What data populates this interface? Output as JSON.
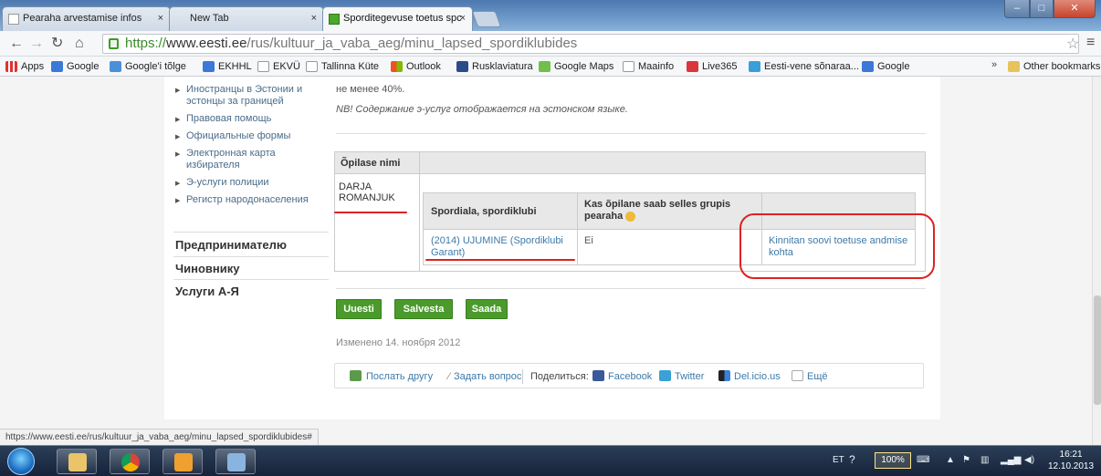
{
  "tabs": [
    {
      "title": "Pearaha arvestamise infos"
    },
    {
      "title": "New Tab"
    },
    {
      "title": "Sporditegevuse toetus spc"
    }
  ],
  "address": {
    "scheme": "https://",
    "host": "www.eesti.ee",
    "path": "/rus/kultuur_ja_vaba_aeg/minu_lapsed_spordiklubides"
  },
  "bookmarks": {
    "items": [
      {
        "label": "Apps",
        "icon": "apps-icon"
      },
      {
        "label": "Google",
        "icon": "google-icon"
      },
      {
        "label": "Google'i tõlge",
        "icon": "translate-icon"
      },
      {
        "label": "EKHHL",
        "icon": "google-icon"
      },
      {
        "label": "EKVÜ",
        "icon": "page-icon"
      },
      {
        "label": "Tallinna Küte",
        "icon": "page-icon"
      },
      {
        "label": "Outlook",
        "icon": "outlook-icon"
      },
      {
        "label": "Rusklaviatura",
        "icon": "rk-icon"
      },
      {
        "label": "Google Maps",
        "icon": "maps-icon"
      },
      {
        "label": "Maainfo",
        "icon": "page-icon"
      },
      {
        "label": "Live365",
        "icon": "live365-icon"
      },
      {
        "label": "Eesti-vene sõnaraa...",
        "icon": "dictionary-icon"
      },
      {
        "label": "Google",
        "icon": "google-icon"
      }
    ],
    "more": "»",
    "other": "Other bookmarks"
  },
  "leftnav": {
    "items": [
      "Иностранцы в Эстонии и эстонцы за границей",
      "Правовая помощь",
      "Официальные формы",
      "Электронная карта избирателя",
      "Э-услуги полиции",
      "Регистр народонаселения"
    ],
    "sections": [
      "Предпринимателю",
      "Чиновнику",
      "Услуги А-Я"
    ]
  },
  "main": {
    "top_text": "не менее 40%.",
    "note": "NB! Содержание э-услуг отображается на эстонском языке.",
    "outer_header": "Õpilase nimi",
    "student_first": "DARJA",
    "student_last": "ROMANJUK",
    "inner_headers": {
      "col1": "Spordiala, spordiklubi",
      "col2_line1": "Kas õpilane saab selles grupis",
      "col2_line2": "pearaha"
    },
    "row": {
      "club_line1": "(2014) UJUMINE (Spordiklubi",
      "club_line2": "Garant)",
      "gets": "Ei",
      "confirm_line1": "Kinnitan soovi toetuse andmise",
      "confirm_line2": "kohta"
    },
    "buttons": {
      "new": "Uuesti",
      "save": "Salvesta",
      "send": "Saada"
    },
    "modified": "Изменено 14. ноября 2012"
  },
  "share": {
    "send_friend": "Послать другу",
    "ask": "Задать вопрос",
    "share_label": "Поделиться:",
    "facebook": "Facebook",
    "twitter": "Twitter",
    "delicious": "Del.icio.us",
    "more": "Ещё"
  },
  "statusbar": {
    "url": "https://www.eesti.ee/rus/kultuur_ja_vaba_aeg/minu_lapsed_spordiklubides#"
  },
  "taskbar": {
    "lang": "ET",
    "zoom": "100%",
    "time": "16:21",
    "date": "12.10.2013"
  }
}
